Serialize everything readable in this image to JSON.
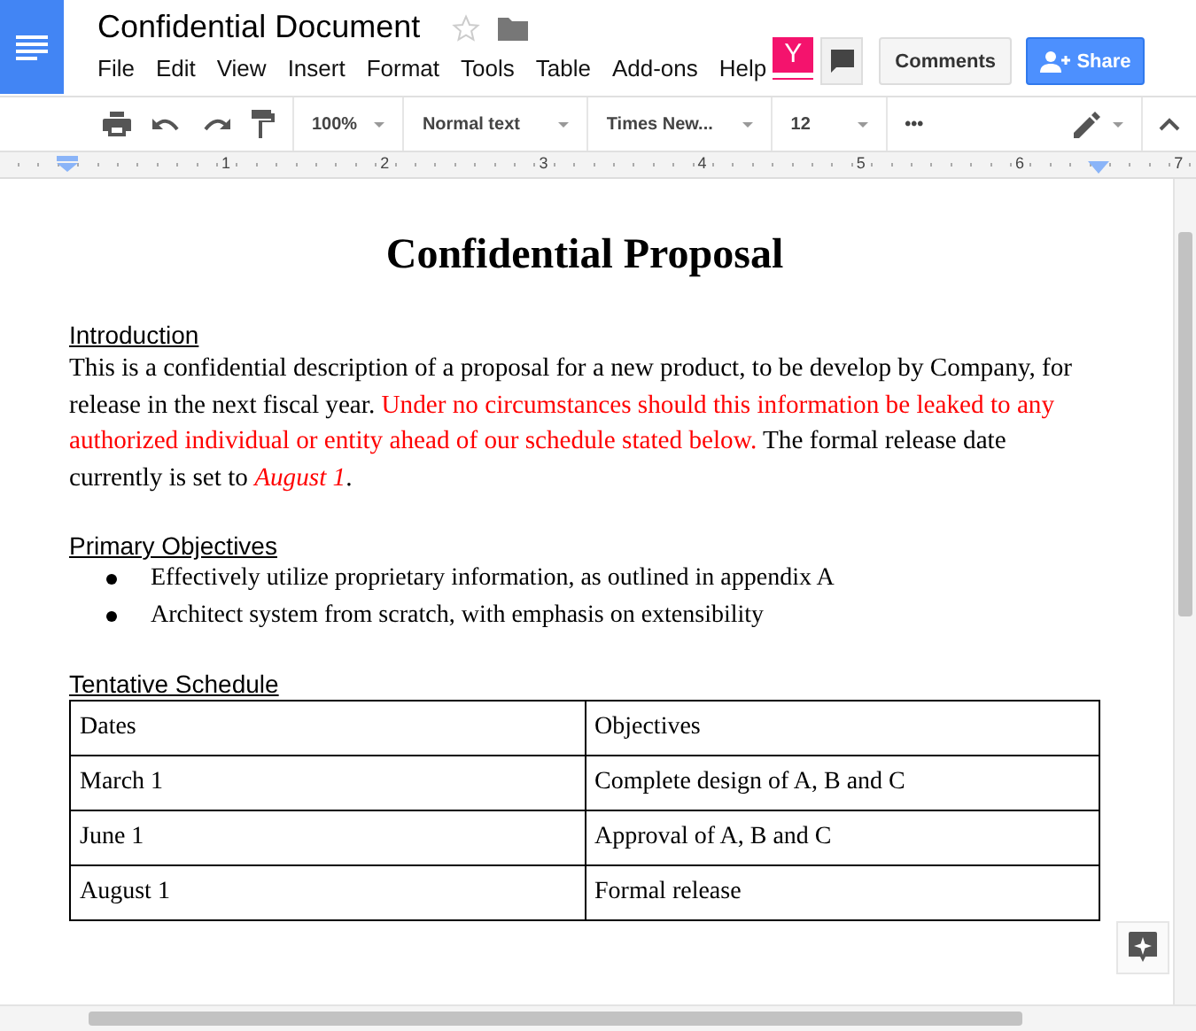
{
  "window": {
    "title": "Confidential Document",
    "starred": false
  },
  "menu": [
    {
      "label": "File"
    },
    {
      "label": "Edit"
    },
    {
      "label": "View"
    },
    {
      "label": "Insert"
    },
    {
      "label": "Format"
    },
    {
      "label": "Tools"
    },
    {
      "label": "Table"
    },
    {
      "label": "Add-ons"
    },
    {
      "label": "Help"
    }
  ],
  "user_badge": "Y",
  "buttons": {
    "comments": "Comments",
    "share": "Share"
  },
  "toolbar": {
    "zoom": "100%",
    "style": "Normal text",
    "font": "Times New...",
    "size": "12",
    "more": "•••"
  },
  "ruler": [
    "1",
    "2",
    "3",
    "4",
    "5",
    "6",
    "7"
  ],
  "document": {
    "title": "Confidential Proposal",
    "sections": [
      {
        "heading": "Introduction",
        "kind": "paragraph",
        "segments": [
          {
            "text": "This is a confidential description of a proposal for a new product, to be develop by Company, for release in the next fiscal year. ",
            "alert": false
          },
          {
            "text": "Under no circumstances should this information be leaked to any authorized individual or entity ahead of our schedule stated below.",
            "alert": true
          },
          {
            "text": " The formal release date currently is set to ",
            "alert": false
          },
          {
            "text": "*August 1*",
            "alert": true
          },
          {
            "text": ".",
            "alert": false
          }
        ]
      },
      {
        "heading": "Primary Objectives",
        "kind": "bullets",
        "items": [
          "Effectively utilize proprietary information, as outlined in appendix A",
          "Architect system from scratch, with emphasis on extensibility"
        ]
      },
      {
        "heading": "Tentative Schedule",
        "kind": "table",
        "rows": [
          [
            "Dates",
            "Objectives"
          ],
          [
            "March 1",
            "Complete design of A, B and C"
          ],
          [
            "June 1",
            "Approval of A, B and C"
          ],
          [
            "August 1",
            "Formal release"
          ]
        ]
      }
    ]
  }
}
